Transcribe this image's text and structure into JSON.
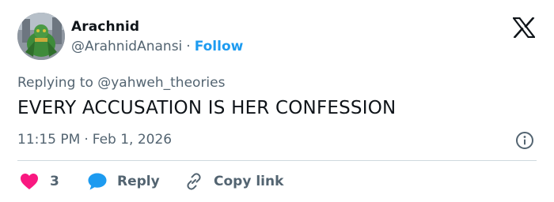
{
  "author": {
    "display_name": "Arachnid",
    "handle": "@ArahnidAnansi",
    "separator": "·",
    "follow_label": "Follow"
  },
  "reply_context": {
    "prefix": "Replying to",
    "target": "@yahweh_theories"
  },
  "tweet": {
    "text": "EVERY ACCUSATION IS HER CONFESSION",
    "time": "11:15 PM",
    "separator": "·",
    "date": "Feb 1, 2026"
  },
  "actions": {
    "like_count": "3",
    "reply_label": "Reply",
    "copy_label": "Copy link"
  },
  "colors": {
    "text": "#0f1419",
    "secondary": "#536471",
    "link": "#1d9bf0",
    "like": "#f91880",
    "divider": "#cfd9de"
  },
  "icons": {
    "brand": "x-logo-icon",
    "info": "info-icon",
    "like": "heart-icon",
    "reply": "speech-bubble-icon",
    "copy": "link-icon"
  }
}
